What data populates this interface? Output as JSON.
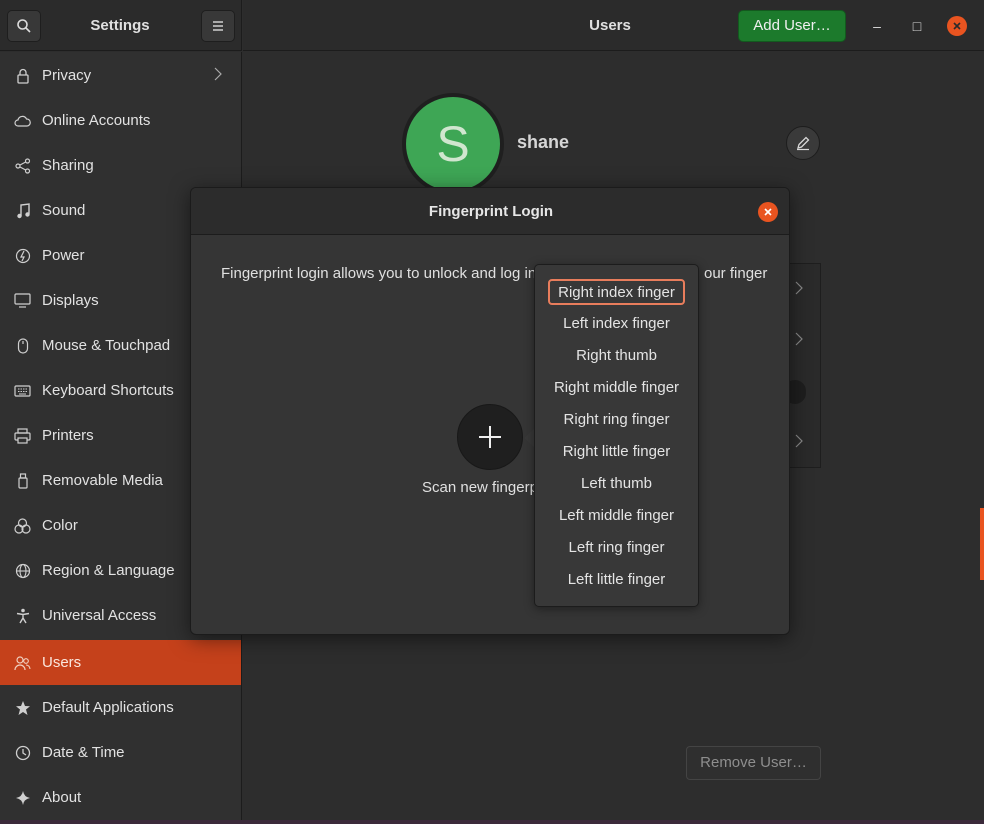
{
  "sidebar": {
    "title": "Settings",
    "items": [
      {
        "label": "Privacy",
        "icon": "lock-icon",
        "has_chevron": true
      },
      {
        "label": "Online Accounts",
        "icon": "cloud-icon"
      },
      {
        "label": "Sharing",
        "icon": "share-icon"
      },
      {
        "label": "Sound",
        "icon": "music-note-icon"
      },
      {
        "label": "Power",
        "icon": "power-icon"
      },
      {
        "label": "Displays",
        "icon": "display-icon"
      },
      {
        "label": "Mouse & Touchpad",
        "icon": "mouse-icon"
      },
      {
        "label": "Keyboard Shortcuts",
        "icon": "keyboard-icon"
      },
      {
        "label": "Printers",
        "icon": "printer-icon"
      },
      {
        "label": "Removable Media",
        "icon": "usb-drive-icon"
      },
      {
        "label": "Color",
        "icon": "color-icon"
      },
      {
        "label": "Region & Language",
        "icon": "globe-icon"
      },
      {
        "label": "Universal Access",
        "icon": "accessibility-icon"
      },
      {
        "label": "Users",
        "icon": "users-icon",
        "active": true
      },
      {
        "label": "Default Applications",
        "icon": "star-icon"
      },
      {
        "label": "Date & Time",
        "icon": "clock-icon"
      },
      {
        "label": "About",
        "icon": "sparkle-icon"
      }
    ]
  },
  "header": {
    "title": "Users",
    "add_user_label": "Add User…",
    "minimize_glyph": "–",
    "maximize_glyph": "□"
  },
  "user": {
    "initial": "S",
    "name": "shane"
  },
  "remove_user_label": "Remove User…",
  "dialog": {
    "title": "Fingerprint Login",
    "description_visible_start": "Fingerprint login allows you to unlock and log in",
    "description_visible_end": "our finger",
    "scan_label": "Scan new fingerp"
  },
  "finger_menu": {
    "selected": "Right index finger",
    "options": [
      "Right index finger",
      "Left index finger",
      "Right thumb",
      "Right middle finger",
      "Right ring finger",
      "Right little finger",
      "Left thumb",
      "Left middle finger",
      "Left ring finger",
      "Left little finger"
    ]
  },
  "colors": {
    "accent": "#e95420",
    "active_row": "#c5411b",
    "add_button": "#1c7a2c",
    "avatar": "#3ea655"
  }
}
